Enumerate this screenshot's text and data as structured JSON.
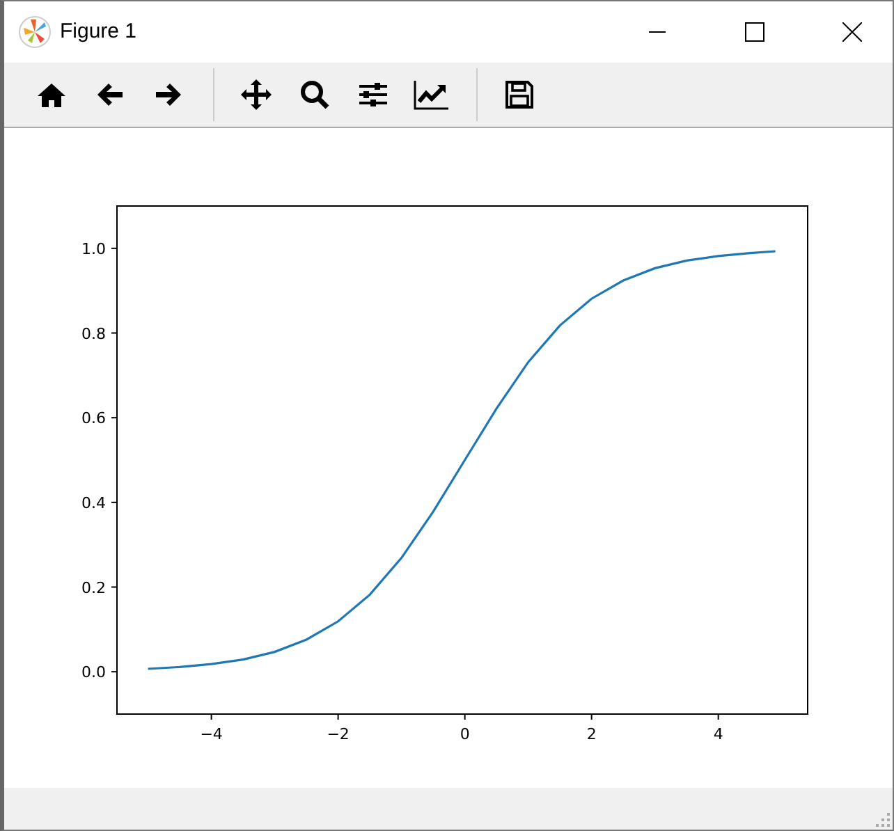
{
  "window": {
    "title": "Figure 1"
  },
  "chart_data": {
    "type": "line",
    "x": [
      -5,
      -4.5,
      -4,
      -3.5,
      -3,
      -2.5,
      -2,
      -1.5,
      -1,
      -0.5,
      0,
      0.5,
      1,
      1.5,
      2,
      2.5,
      3,
      3.5,
      4,
      4.5,
      4.9
    ],
    "series": [
      {
        "color": "#1f77b4",
        "values": [
          0.007,
          0.011,
          0.018,
          0.029,
          0.047,
          0.076,
          0.119,
          0.182,
          0.269,
          0.378,
          0.5,
          0.622,
          0.731,
          0.818,
          0.881,
          0.924,
          0.953,
          0.971,
          0.982,
          0.989,
          0.993
        ]
      }
    ],
    "xlim": [
      -5.49,
      5.41
    ],
    "ylim": [
      -0.1,
      1.1
    ],
    "xticks": [
      {
        "value": -4,
        "label": "−4"
      },
      {
        "value": -2,
        "label": "−2"
      },
      {
        "value": 0,
        "label": "0"
      },
      {
        "value": 2,
        "label": "2"
      },
      {
        "value": 4,
        "label": "4"
      }
    ],
    "yticks": [
      {
        "value": 0,
        "label": "0.0"
      },
      {
        "value": 0.2,
        "label": "0.2"
      },
      {
        "value": 0.4,
        "label": "0.4"
      },
      {
        "value": 0.6,
        "label": "0.6"
      },
      {
        "value": 0.8,
        "label": "0.8"
      },
      {
        "value": 1,
        "label": "1.0"
      }
    ]
  }
}
